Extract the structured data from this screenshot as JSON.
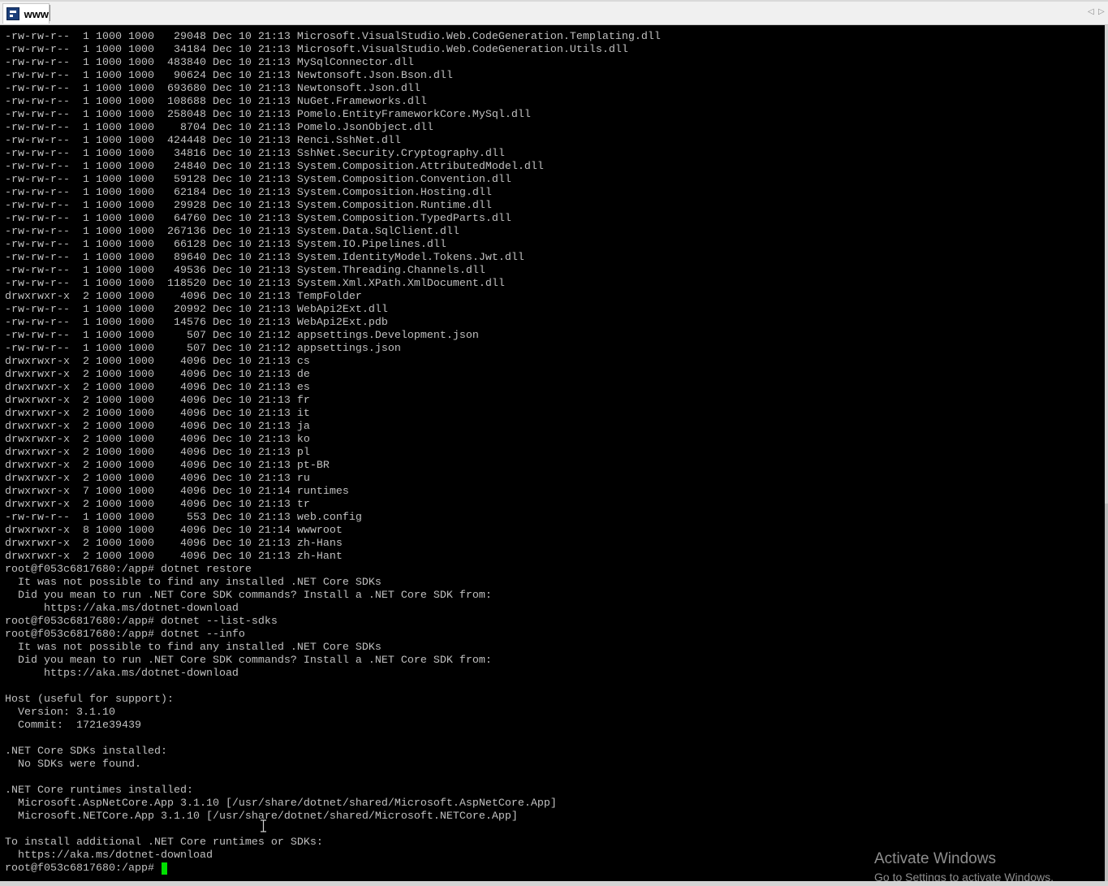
{
  "tab": {
    "title": "www",
    "icon": "putty-terminal-icon"
  },
  "nav": {
    "left": "◁",
    "right": "▷"
  },
  "terminal": {
    "lines": [
      "-rw-rw-r--  1 1000 1000   29048 Dec 10 21:13 Microsoft.VisualStudio.Web.CodeGeneration.Templating.dll",
      "-rw-rw-r--  1 1000 1000   34184 Dec 10 21:13 Microsoft.VisualStudio.Web.CodeGeneration.Utils.dll",
      "-rw-rw-r--  1 1000 1000  483840 Dec 10 21:13 MySqlConnector.dll",
      "-rw-rw-r--  1 1000 1000   90624 Dec 10 21:13 Newtonsoft.Json.Bson.dll",
      "-rw-rw-r--  1 1000 1000  693680 Dec 10 21:13 Newtonsoft.Json.dll",
      "-rw-rw-r--  1 1000 1000  108688 Dec 10 21:13 NuGet.Frameworks.dll",
      "-rw-rw-r--  1 1000 1000  258048 Dec 10 21:13 Pomelo.EntityFrameworkCore.MySql.dll",
      "-rw-rw-r--  1 1000 1000    8704 Dec 10 21:13 Pomelo.JsonObject.dll",
      "-rw-rw-r--  1 1000 1000  424448 Dec 10 21:13 Renci.SshNet.dll",
      "-rw-rw-r--  1 1000 1000   34816 Dec 10 21:13 SshNet.Security.Cryptography.dll",
      "-rw-rw-r--  1 1000 1000   24840 Dec 10 21:13 System.Composition.AttributedModel.dll",
      "-rw-rw-r--  1 1000 1000   59128 Dec 10 21:13 System.Composition.Convention.dll",
      "-rw-rw-r--  1 1000 1000   62184 Dec 10 21:13 System.Composition.Hosting.dll",
      "-rw-rw-r--  1 1000 1000   29928 Dec 10 21:13 System.Composition.Runtime.dll",
      "-rw-rw-r--  1 1000 1000   64760 Dec 10 21:13 System.Composition.TypedParts.dll",
      "-rw-rw-r--  1 1000 1000  267136 Dec 10 21:13 System.Data.SqlClient.dll",
      "-rw-rw-r--  1 1000 1000   66128 Dec 10 21:13 System.IO.Pipelines.dll",
      "-rw-rw-r--  1 1000 1000   89640 Dec 10 21:13 System.IdentityModel.Tokens.Jwt.dll",
      "-rw-rw-r--  1 1000 1000   49536 Dec 10 21:13 System.Threading.Channels.dll",
      "-rw-rw-r--  1 1000 1000  118520 Dec 10 21:13 System.Xml.XPath.XmlDocument.dll",
      "drwxrwxr-x  2 1000 1000    4096 Dec 10 21:13 TempFolder",
      "-rw-rw-r--  1 1000 1000   20992 Dec 10 21:13 WebApi2Ext.dll",
      "-rw-rw-r--  1 1000 1000   14576 Dec 10 21:13 WebApi2Ext.pdb",
      "-rw-rw-r--  1 1000 1000     507 Dec 10 21:12 appsettings.Development.json",
      "-rw-rw-r--  1 1000 1000     507 Dec 10 21:12 appsettings.json",
      "drwxrwxr-x  2 1000 1000    4096 Dec 10 21:13 cs",
      "drwxrwxr-x  2 1000 1000    4096 Dec 10 21:13 de",
      "drwxrwxr-x  2 1000 1000    4096 Dec 10 21:13 es",
      "drwxrwxr-x  2 1000 1000    4096 Dec 10 21:13 fr",
      "drwxrwxr-x  2 1000 1000    4096 Dec 10 21:13 it",
      "drwxrwxr-x  2 1000 1000    4096 Dec 10 21:13 ja",
      "drwxrwxr-x  2 1000 1000    4096 Dec 10 21:13 ko",
      "drwxrwxr-x  2 1000 1000    4096 Dec 10 21:13 pl",
      "drwxrwxr-x  2 1000 1000    4096 Dec 10 21:13 pt-BR",
      "drwxrwxr-x  2 1000 1000    4096 Dec 10 21:13 ru",
      "drwxrwxr-x  7 1000 1000    4096 Dec 10 21:14 runtimes",
      "drwxrwxr-x  2 1000 1000    4096 Dec 10 21:13 tr",
      "-rw-rw-r--  1 1000 1000     553 Dec 10 21:13 web.config",
      "drwxrwxr-x  8 1000 1000    4096 Dec 10 21:14 wwwroot",
      "drwxrwxr-x  2 1000 1000    4096 Dec 10 21:13 zh-Hans",
      "drwxrwxr-x  2 1000 1000    4096 Dec 10 21:13 zh-Hant",
      "root@f053c6817680:/app# dotnet restore",
      "  It was not possible to find any installed .NET Core SDKs",
      "  Did you mean to run .NET Core SDK commands? Install a .NET Core SDK from:",
      "      https://aka.ms/dotnet-download",
      "root@f053c6817680:/app# dotnet --list-sdks",
      "root@f053c6817680:/app# dotnet --info",
      "  It was not possible to find any installed .NET Core SDKs",
      "  Did you mean to run .NET Core SDK commands? Install a .NET Core SDK from:",
      "      https://aka.ms/dotnet-download",
      "",
      "Host (useful for support):",
      "  Version: 3.1.10",
      "  Commit:  1721e39439",
      "",
      ".NET Core SDKs installed:",
      "  No SDKs were found.",
      "",
      ".NET Core runtimes installed:",
      "  Microsoft.AspNetCore.App 3.1.10 [/usr/share/dotnet/shared/Microsoft.AspNetCore.App]",
      "  Microsoft.NETCore.App 3.1.10 [/usr/share/dotnet/shared/Microsoft.NETCore.App]",
      "",
      "To install additional .NET Core runtimes or SDKs:",
      "  https://aka.ms/dotnet-download"
    ],
    "prompt": "root@f053c6817680:/app# ",
    "text_color": "#c0c0c0",
    "background": "#000000",
    "cursor_color": "#00e000"
  },
  "watermark": {
    "title": "Activate Windows",
    "subtitle": "Go to Settings to activate Windows."
  }
}
